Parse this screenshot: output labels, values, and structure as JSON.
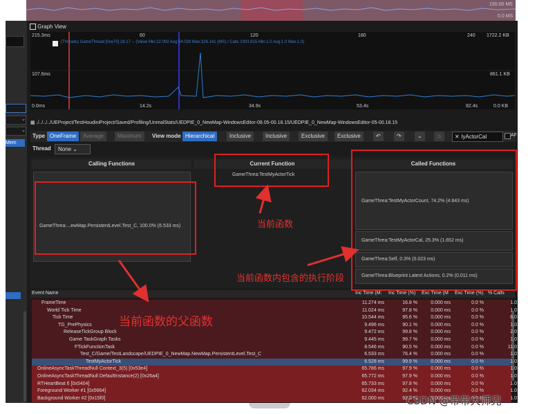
{
  "top": {
    "ms1": "150.00 MS",
    "ms2": "0.0 MS"
  },
  "graph": {
    "title": "Graph View",
    "y_labels": [
      "215.3ms",
      "107.6ms",
      "0.0ms"
    ],
    "x_labels": [
      "60",
      "120",
      "180",
      "240"
    ],
    "x_time_labels": [
      "14.2s",
      "34.9s",
      "53.4s",
      "82.4s"
    ],
    "right_labels": [
      "1722.2 KB",
      "861.1 KB",
      "0.0 KB"
    ],
    "legend": "(Threads) GameThread [0xe70] 28.17 -- (Value Min:22.092 Avg:54.028 Max:326.141 (MS) / Calls 1003.615 Min:1.0 Avg:1.0 Max:1.0)"
  },
  "path": "./../../../UEProject/TestHoudiniProject/Saved/Profiling/UnrealStats/UEDPIE_0_NewMap-WindowsEditor-08.05-00.18.15/UEDPIE_0_NewMap-WindowsEditor-05-00.18.15",
  "toolbar": {
    "type_label": "Type",
    "oneframe": "OneFrame",
    "average": "Average",
    "maximum": "Maximum",
    "view_mode": "View mode",
    "hierarchical": "Hierarchical",
    "inclusive1": "Inclusive",
    "inclusive2": "Inclusive",
    "exclusive1": "Exclusive",
    "exclusive2": "Exclusive",
    "search": "lyActorCal",
    "af": "AF"
  },
  "thread": {
    "label": "Thread",
    "value": "None"
  },
  "sections": {
    "calling": "Calling Functions",
    "current": "Current Function",
    "called": "Called Functions"
  },
  "calling_item": "GameThrea:...ewMap.PersistentLevel.Test_C, 100.0% (6.533 ms)",
  "current_item": "GameThrea:TestMyActorTick",
  "called_items": [
    "GameThrea:TestMyActorCount, 74.2% (4.843 ms)",
    "GameThrea:TestMyActorCal, 25.3% (1.652 ms)",
    "GameThrea:Self, 0.3% (0.023 ms)",
    "GameThrea:Blueprint Latent Actions, 0.2% (0.011 ms)"
  ],
  "annotations": {
    "current": "当前函数",
    "phases": "当前函数内包含的执行阶段",
    "parent": "当前函数的父函数"
  },
  "left_tabs": {
    "mem": "Mem"
  },
  "event_headers": [
    "Event Name",
    "Inc Time (M:",
    "Inc Time (%)",
    "Exc Time (M",
    "Exc Time (%)",
    "% Calls"
  ],
  "events": [
    {
      "name": "FrameTime",
      "indent": 0,
      "inc": "11.274 ms",
      "incp": "16.8 %",
      "exc": "0.000 ms",
      "excp": "0.0 %",
      "calls": "1.0"
    },
    {
      "name": "World Tick Time",
      "indent": 1,
      "inc": "11.024 ms",
      "incp": "97.8 %",
      "exc": "0.000 ms",
      "excp": "0.0 %",
      "calls": "1.0"
    },
    {
      "name": "Tick Time",
      "indent": 2,
      "inc": "10.544 ms",
      "incp": "95.6 %",
      "exc": "0.000 ms",
      "excp": "0.0 %",
      "calls": "6.0"
    },
    {
      "name": "TG_PrePhysics",
      "indent": 3,
      "inc": "9.496 ms",
      "incp": "90.1 %",
      "exc": "0.000 ms",
      "excp": "0.0 %",
      "calls": "1.0"
    },
    {
      "name": "ReleaseTickGroup Block",
      "indent": 4,
      "inc": "9.472 ms",
      "incp": "99.8 %",
      "exc": "0.000 ms",
      "excp": "0.0 %",
      "calls": "2.0"
    },
    {
      "name": "Game TaskGraph Tasks",
      "indent": 5,
      "inc": "9.445 ms",
      "incp": "99.7 %",
      "exc": "0.000 ms",
      "excp": "0.0 %",
      "calls": "1.0"
    },
    {
      "name": "FTickFunctionTask",
      "indent": 6,
      "inc": "8.546 ms",
      "incp": "90.5 %",
      "exc": "0.000 ms",
      "excp": "0.0 %",
      "calls": "11.0"
    },
    {
      "name": "Test_C/Game/TestLandscape/UEDPIE_0_NewMap.NewMap.PersistentLevel.Test_C",
      "indent": 7,
      "inc": "6.533 ms",
      "incp": "76.4 %",
      "exc": "0.000 ms",
      "excp": "0.0 %",
      "calls": "1.0"
    },
    {
      "name": "TestMyActorTick",
      "indent": 8,
      "inc": "6.528 ms",
      "incp": "99.9 %",
      "exc": "0.000 ms",
      "excp": "0.0 %",
      "calls": "1.0",
      "selected": true
    },
    {
      "name": "OnlineAsyncTaskThreadNull Context_3(5) [0x53e4]",
      "indent": 0,
      "inc": "65.786 ms",
      "incp": "97.9 %",
      "exc": "0.000 ms",
      "excp": "0.0 %",
      "calls": "1.0"
    },
    {
      "name": "OnlineAsyncTaskThreadNull DefaultInstance(2) [0x26a4]",
      "indent": 0,
      "inc": "65.772 ms",
      "incp": "97.9 %",
      "exc": "0.000 ms",
      "excp": "0.0 %",
      "calls": "1.0"
    },
    {
      "name": "RTHeartBeat 6 [0x5404]",
      "indent": 0,
      "inc": "65.733 ms",
      "incp": "97.8 %",
      "exc": "0.000 ms",
      "excp": "0.0 %",
      "calls": "1.0"
    },
    {
      "name": "Foreground Worker #1 [0x5664]",
      "indent": 0,
      "inc": "62.034 ms",
      "incp": "92.4 %",
      "exc": "0.000 ms",
      "excp": "0.0 %",
      "calls": "1.0"
    },
    {
      "name": "Background Worker #2 [0x15f0]",
      "indent": 0,
      "inc": "62.000 ms",
      "incp": "92.3 %",
      "exc": "0.000 ms",
      "excp": "0.0 %",
      "calls": "1.0"
    }
  ],
  "watermark": "CSDN @带带大师兄"
}
